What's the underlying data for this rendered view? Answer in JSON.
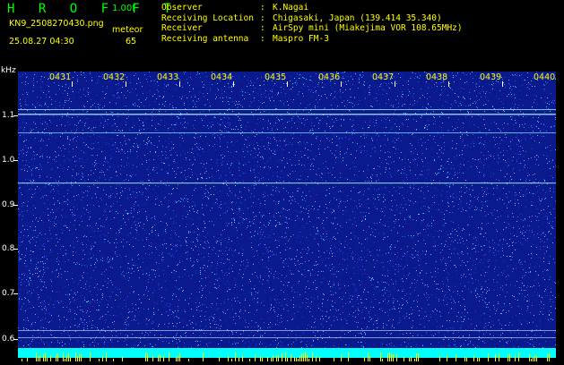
{
  "header": {
    "title": "H R O F F T",
    "version": "1.00f",
    "file_name": "KN9_2508270430.png",
    "meteor_label": "meteor",
    "datetime": "25.08.27 04:30",
    "meteor_count": "65",
    "info": [
      {
        "key": "Observer",
        "value": "K.Nagai"
      },
      {
        "key": "Receiving Location",
        "value": "Chigasaki, Japan (139.414 35.340)"
      },
      {
        "key": "Receiver",
        "value": "AirSpy mini (Miakejima VOR 108.65MHz)"
      },
      {
        "key": "Receiving antenna",
        "value": "Maspro FM-3"
      }
    ]
  },
  "y_axis": {
    "unit": "kHz",
    "labels": [
      "1.1",
      "1.0",
      "0.9",
      "0.8",
      "0.7",
      "0.6"
    ]
  },
  "time_axis": {
    "labels": [
      "0431",
      "0432",
      "0433",
      "0434",
      "0435",
      "0436",
      "0437",
      "0438",
      "0439",
      "0440"
    ]
  },
  "colors": {
    "background": "#000000",
    "title_green": "#00ff00",
    "text_yellow": "#ffff00",
    "spectrogram_base": "#0a1a8c",
    "bottom_band": "#00ffff"
  }
}
